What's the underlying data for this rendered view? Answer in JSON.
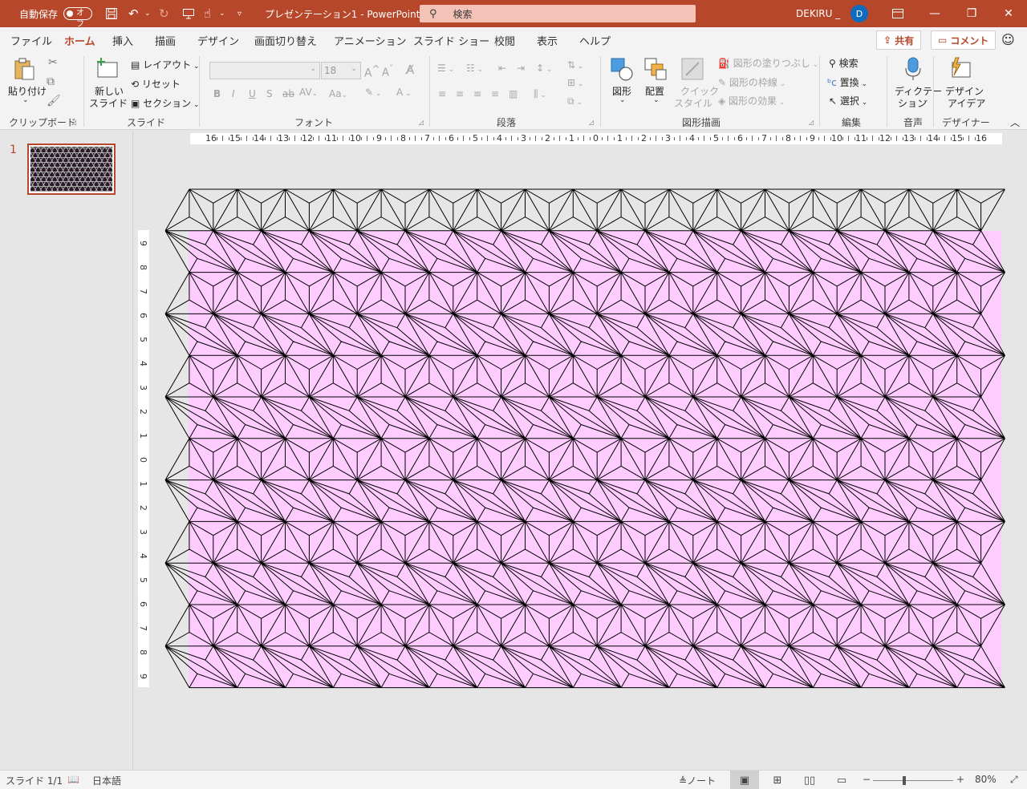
{
  "titlebar": {
    "autosave_label": "自動保存",
    "autosave_state": "オフ",
    "doc_title": "プレゼンテーション1  -  PowerPoint",
    "search_placeholder": "検索",
    "user_name": "DEKIRU _",
    "user_initial": "D"
  },
  "tabs": [
    "ファイル",
    "ホーム",
    "挿入",
    "描画",
    "デザイン",
    "画面切り替え",
    "アニメーション",
    "スライド ショー",
    "校閲",
    "表示",
    "ヘルプ"
  ],
  "tab_buttons": {
    "share": "共有",
    "comment": "コメント"
  },
  "ribbon": {
    "clipboard": {
      "paste": "貼り付け",
      "label": "クリップボード"
    },
    "slides": {
      "new_slide_1": "新しい",
      "new_slide_2": "スライド",
      "layout": "レイアウト",
      "reset": "リセット",
      "section": "セクション",
      "label": "スライド"
    },
    "font": {
      "size": "18",
      "label": "フォント"
    },
    "paragraph": {
      "label": "段落"
    },
    "drawing": {
      "shapes": "図形",
      "arrange": "配置",
      "quick_1": "クイック",
      "quick_2": "スタイル",
      "fill": "図形の塗りつぶし",
      "outline": "図形の枠線",
      "effects": "図形の効果",
      "label": "図形描画"
    },
    "editing": {
      "find": "検索",
      "replace": "置換",
      "select": "選択",
      "label": "編集"
    },
    "voice": {
      "dictate_1": "ディクテー",
      "dictate_2": "ション",
      "label": "音声"
    },
    "designer": {
      "ideas_1": "デザイン",
      "ideas_2": "アイデア",
      "label": "デザイナー"
    }
  },
  "thumbnails": {
    "slide_number": "1"
  },
  "ruler": {
    "horizontal": [
      "16",
      "15",
      "14",
      "13",
      "12",
      "11",
      "10",
      "9",
      "8",
      "7",
      "6",
      "5",
      "4",
      "3",
      "2",
      "1",
      "0",
      "1",
      "2",
      "3",
      "4",
      "5",
      "6",
      "7",
      "8",
      "9",
      "10",
      "11",
      "12",
      "13",
      "14",
      "15",
      "16"
    ],
    "vertical": [
      "9",
      "8",
      "7",
      "6",
      "5",
      "4",
      "3",
      "2",
      "1",
      "0",
      "1",
      "2",
      "3",
      "4",
      "5",
      "6",
      "7",
      "8",
      "9"
    ]
  },
  "slide": {
    "fill_color": "#ffccff",
    "line_color": "#000000"
  },
  "statusbar": {
    "slide_info": "スライド 1/1",
    "language": "日本語",
    "notes": "ノート",
    "zoom": "80%"
  }
}
